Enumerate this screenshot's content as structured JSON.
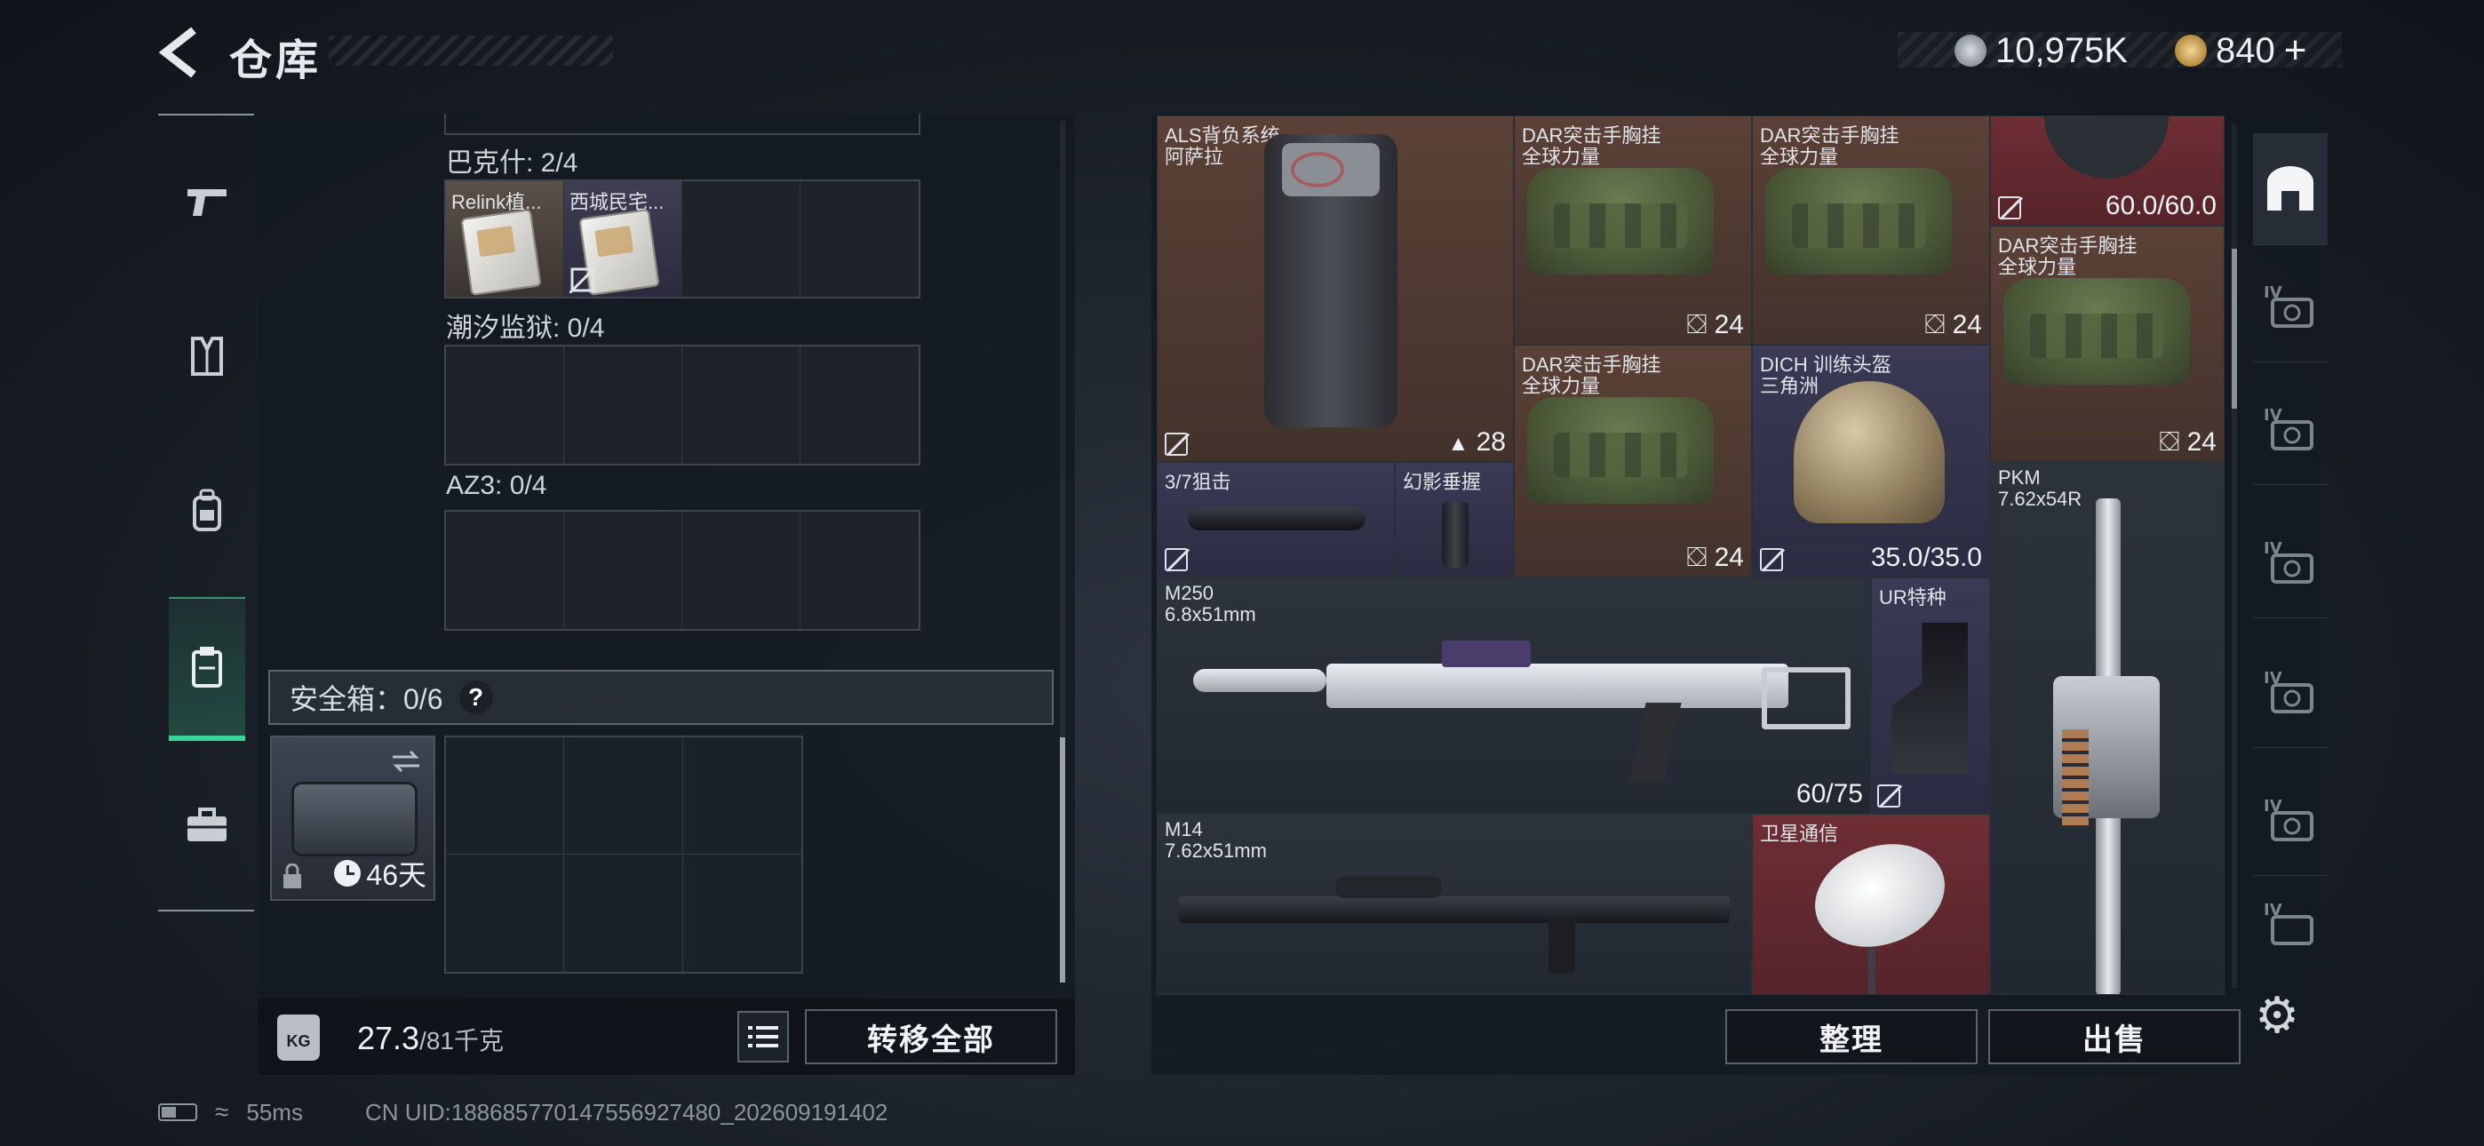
{
  "header": {
    "title": "仓库",
    "currency_silver": "10,975K",
    "currency_gold": "840",
    "add_label": "+"
  },
  "sidebar": {
    "items": [
      {
        "name": "weapons",
        "icon": "pistol-icon"
      },
      {
        "name": "armor",
        "icon": "vest-icon"
      },
      {
        "name": "backpack",
        "icon": "backpack-icon"
      },
      {
        "name": "containers",
        "icon": "clipboard-icon",
        "active": true
      },
      {
        "name": "toolbox",
        "icon": "toolbox-icon"
      }
    ]
  },
  "left": {
    "sections": [
      {
        "label": "巴克什: 2/4",
        "items": [
          "Relink植...",
          "西城民宅..."
        ]
      },
      {
        "label": "潮汐监狱: 0/4",
        "items": []
      },
      {
        "label": "AZ3: 0/4",
        "items": []
      }
    ],
    "safe_box": {
      "label": "安全箱：0/6",
      "help": "?",
      "days": "46天"
    },
    "weight": {
      "current": "27.3",
      "max": "/81千克",
      "icon": "KG"
    },
    "transfer_all": "转移全部"
  },
  "stash": {
    "items": [
      {
        "l1": "ALS背负系统",
        "l2": "阿萨拉",
        "br": "28"
      },
      {
        "l1": "DAR突击手胸挂",
        "l2": "全球力量",
        "br": "24"
      },
      {
        "l1": "DAR突击手胸挂",
        "l2": "全球力量",
        "br": "24"
      },
      {
        "l1": "",
        "l2": "",
        "br": "60.0/60.0"
      },
      {
        "l1": "DAR突击手胸挂",
        "l2": "全球力量",
        "br": "24"
      },
      {
        "l1": "DAR突击手胸挂",
        "l2": "全球力量",
        "br": "24"
      },
      {
        "l1": "DICH 训练头盔",
        "l2": "三角洲",
        "br": "35.0/35.0"
      },
      {
        "l1": "3/7狙击",
        "l2": "",
        "br": ""
      },
      {
        "l1": "幻影垂握",
        "l2": "",
        "br": ""
      },
      {
        "l1": "PKM",
        "l2": "7.62x54R",
        "br": ""
      },
      {
        "l1": "M250",
        "l2": "6.8x51mm",
        "br": "60/75"
      },
      {
        "l1": "UR特种",
        "l2": "",
        "br": ""
      },
      {
        "l1": "M14",
        "l2": "7.62x51mm",
        "br": ""
      },
      {
        "l1": "卫星通信",
        "l2": "",
        "br": ""
      }
    ],
    "organize": "整理",
    "sell": "出售"
  },
  "category_rail": [
    "bunker-icon",
    "iv-tag-icon",
    "iv-tag-icon",
    "iv-tag-icon",
    "iv-tag-icon",
    "iv-tag-icon",
    "iv-tag-icon"
  ],
  "footer": {
    "ping": "55ms",
    "uid": "CN UID:1886857701475569274​80_202609191402"
  },
  "colors": {
    "accent_green": "#38d49a",
    "brown_cell": "#5b4136",
    "purple_cell": "#3a3a55",
    "red_cell": "#6e2e34"
  }
}
